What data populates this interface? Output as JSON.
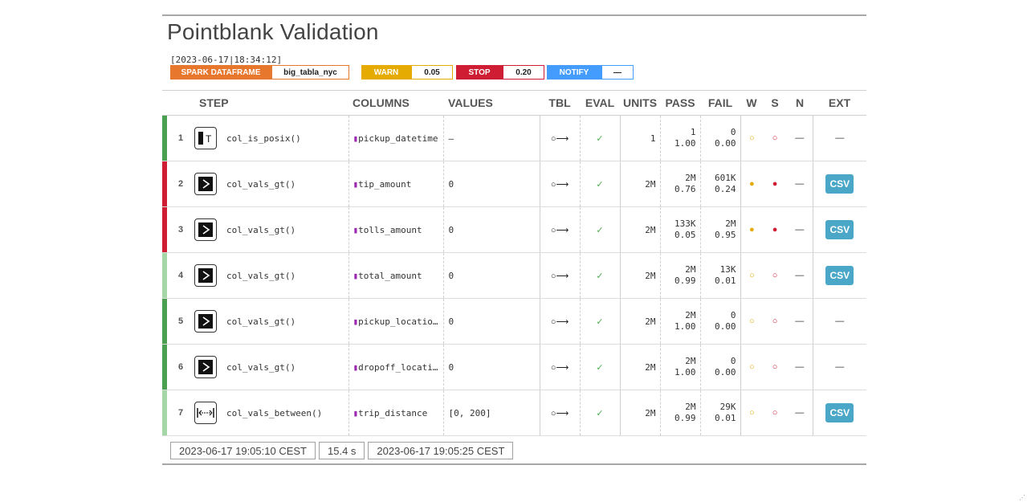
{
  "title": "Pointblank Validation",
  "timestamp": "[2023-06-17|18:34:12]",
  "badges": {
    "spark": {
      "label": "SPARK DATAFRAME",
      "value": "big_tabla_nyc"
    },
    "warn": {
      "label": "WARN",
      "value": "0.05"
    },
    "stop": {
      "label": "STOP",
      "value": "0.20"
    },
    "notify": {
      "label": "NOTIFY",
      "value": "—"
    }
  },
  "headers": {
    "step": "STEP",
    "columns": "COLUMNS",
    "values": "VALUES",
    "tbl": "TBL",
    "eval": "EVAL",
    "units": "UNITS",
    "pass": "PASS",
    "fail": "FAIL",
    "w": "W",
    "s": "S",
    "n": "N",
    "ext": "EXT"
  },
  "colors": {
    "green": "#4aa050",
    "light_green": "#a5d6a7",
    "red": "#cf1d33",
    "warn": "#e5ab00",
    "csv": "#4aa7c7"
  },
  "rows": [
    {
      "step": "1",
      "icon": "col-is-posix-icon",
      "fn": "col_is_posix()",
      "column": "pickup_datetime",
      "values": "—",
      "tbl": "○⟶",
      "eval": "✓",
      "units": "1",
      "pass_n": "1",
      "pass_f": "1.00",
      "fail_n": "0",
      "fail_f": "0.00",
      "w": "○",
      "s": "○",
      "n": "—",
      "ext": "—",
      "status": "green"
    },
    {
      "step": "2",
      "icon": "col-vals-gt-icon",
      "fn": "col_vals_gt()",
      "column": "tip_amount",
      "values": "0",
      "tbl": "○⟶",
      "eval": "✓",
      "units": "2M",
      "pass_n": "2M",
      "pass_f": "0.76",
      "fail_n": "601K",
      "fail_f": "0.24",
      "w": "●",
      "s": "●",
      "n": "—",
      "ext": "CSV",
      "status": "red"
    },
    {
      "step": "3",
      "icon": "col-vals-gt-icon",
      "fn": "col_vals_gt()",
      "column": "tolls_amount",
      "values": "0",
      "tbl": "○⟶",
      "eval": "✓",
      "units": "2M",
      "pass_n": "133K",
      "pass_f": "0.05",
      "fail_n": "2M",
      "fail_f": "0.95",
      "w": "●",
      "s": "●",
      "n": "—",
      "ext": "CSV",
      "status": "red"
    },
    {
      "step": "4",
      "icon": "col-vals-gt-icon",
      "fn": "col_vals_gt()",
      "column": "total_amount",
      "values": "0",
      "tbl": "○⟶",
      "eval": "✓",
      "units": "2M",
      "pass_n": "2M",
      "pass_f": "0.99",
      "fail_n": "13K",
      "fail_f": "0.01",
      "w": "○",
      "s": "○",
      "n": "—",
      "ext": "CSV",
      "status": "light_green"
    },
    {
      "step": "5",
      "icon": "col-vals-gt-icon",
      "fn": "col_vals_gt()",
      "column": "pickup_locatio…",
      "values": "0",
      "tbl": "○⟶",
      "eval": "✓",
      "units": "2M",
      "pass_n": "2M",
      "pass_f": "1.00",
      "fail_n": "0",
      "fail_f": "0.00",
      "w": "○",
      "s": "○",
      "n": "—",
      "ext": "—",
      "status": "green"
    },
    {
      "step": "6",
      "icon": "col-vals-gt-icon",
      "fn": "col_vals_gt()",
      "column": "dropoff_locati…",
      "values": "0",
      "tbl": "○⟶",
      "eval": "✓",
      "units": "2M",
      "pass_n": "2M",
      "pass_f": "1.00",
      "fail_n": "0",
      "fail_f": "0.00",
      "w": "○",
      "s": "○",
      "n": "—",
      "ext": "—",
      "status": "green"
    },
    {
      "step": "7",
      "icon": "col-vals-between-icon",
      "fn": "col_vals_between()",
      "column": "trip_distance",
      "values": "[0, 200]",
      "tbl": "○⟶",
      "eval": "✓",
      "units": "2M",
      "pass_n": "2M",
      "pass_f": "0.99",
      "fail_n": "29K",
      "fail_f": "0.01",
      "w": "○",
      "s": "○",
      "n": "—",
      "ext": "CSV",
      "status": "light_green"
    }
  ],
  "footer": {
    "start": "2023-06-17 19:05:10 CEST",
    "duration": "15.4 s",
    "end": "2023-06-17 19:05:25 CEST"
  }
}
